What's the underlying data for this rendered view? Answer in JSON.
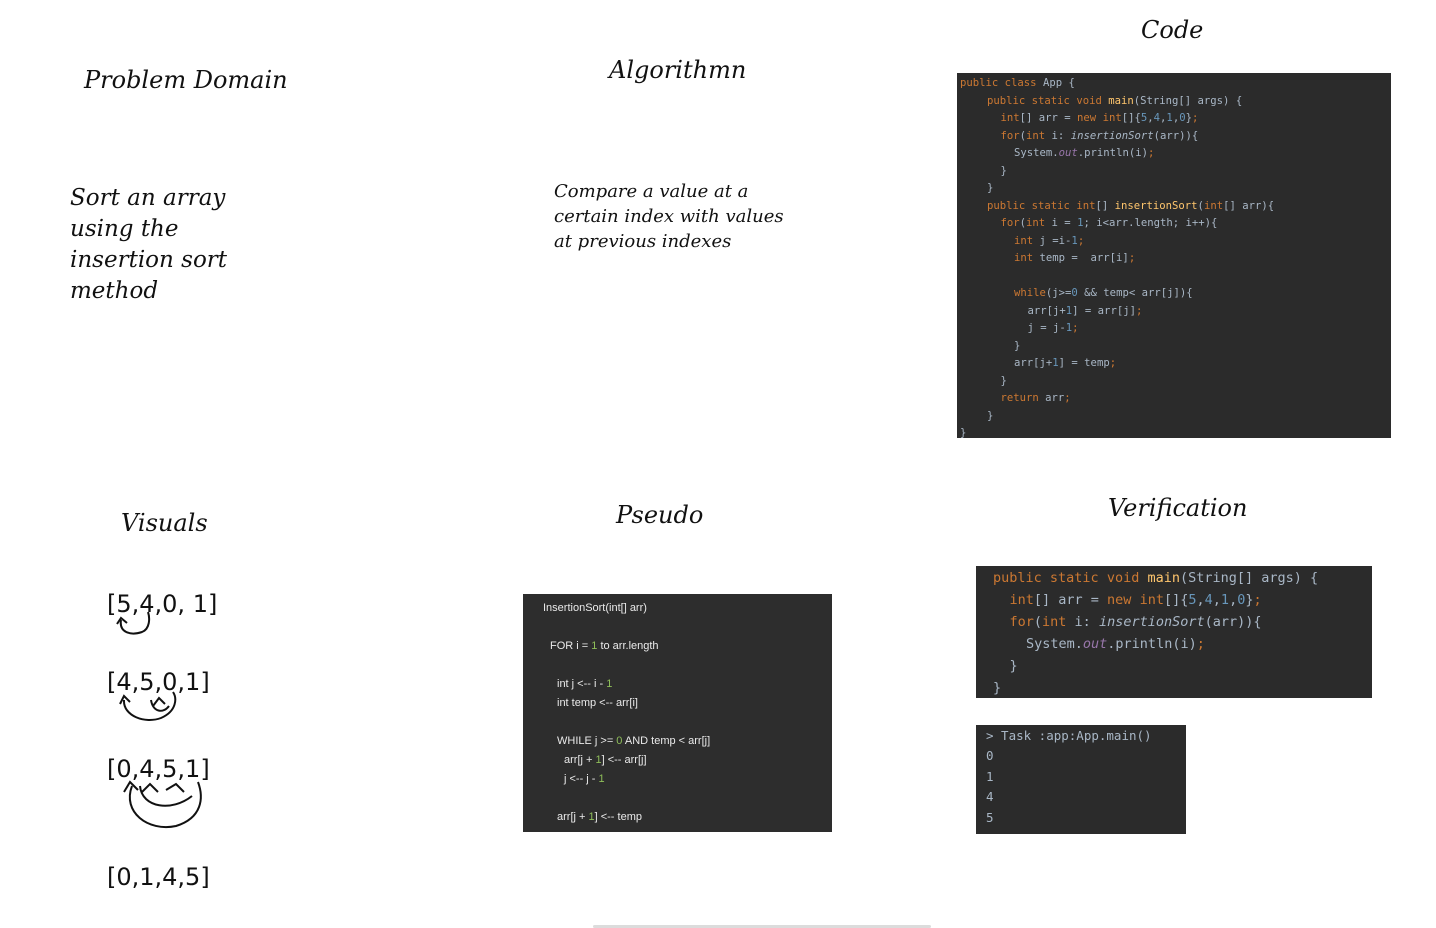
{
  "headings": {
    "problem": "Problem Domain",
    "algorithm": "Algorithmn",
    "code": "Code",
    "visuals": "Visuals",
    "pseudo": "Pseudo",
    "verification": "Verification"
  },
  "problem_text": [
    "Sort an array",
    "using the",
    "insertion sort",
    "method"
  ],
  "algorithm_text": [
    "Compare a value at a",
    "certain index with values",
    "at previous indexes"
  ],
  "code_lines": [
    "public class App {",
    "public static void main(String[] args) {",
    "int[] arr = new int[]{5,4,1,0};",
    "for(int i: insertionSort(arr)){",
    "System.out.println(i);",
    "}",
    "}",
    "public static int[] insertionSort(int[] arr){",
    "for(int i = 1; i<arr.length; i++){",
    "int j =i-1;",
    "int temp =  arr[i];",
    "",
    "while(j>=0 && temp< arr[j]){",
    "arr[j+1] = arr[j];",
    "j = j-1;",
    "}",
    "arr[j+1] = temp;",
    "}",
    "return arr;",
    "}",
    "}"
  ],
  "verify_code_lines": [
    "public static void main(String[] args) {",
    "int[] arr = new int[]{5,4,1,0};",
    "for(int i: insertionSort(arr)){",
    "System.out.println(i);",
    "}",
    "}"
  ],
  "console_lines": [
    "> Task :app:App.main()",
    "0",
    "1",
    "4",
    "5"
  ],
  "pseudo_lines": [
    "InsertionSort(int[] arr)",
    "FOR i = 1 to arr.length",
    "int j <-- i - 1",
    "int temp <-- arr[i]",
    "WHILE j >= 0 AND temp < arr[j]",
    "arr[j + 1] <-- arr[j]",
    "j <-- j - 1",
    "arr[j + 1] <-- temp"
  ],
  "visual_arrays": [
    "[5,4,0, 1]",
    "[4,5,0,1]",
    "[0,4,5,1]",
    "[0,1,4,5]"
  ],
  "colors": {
    "code_background": "#2b2b2b",
    "keyword": "#cc7832",
    "method": "#ffc66d",
    "number": "#6897bb",
    "field": "#9876aa",
    "plain_code": "#a9b7c6"
  }
}
